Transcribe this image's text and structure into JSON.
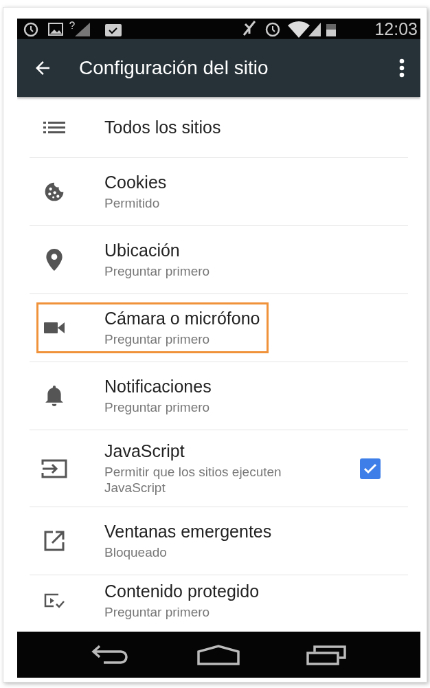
{
  "status_bar": {
    "time": "12:03"
  },
  "toolbar": {
    "title": "Configuración del sitio"
  },
  "items": [
    {
      "kind": "link",
      "title": "Todos los sitios",
      "highlighted": false
    },
    {
      "kind": "setting",
      "title": "Cookies",
      "subtitle": "Permitido",
      "highlighted": false
    },
    {
      "kind": "setting",
      "title": "Ubicación",
      "subtitle": "Preguntar primero",
      "highlighted": false
    },
    {
      "kind": "setting",
      "title": "Cámara o micrófono",
      "subtitle": "Preguntar primero",
      "highlighted": true
    },
    {
      "kind": "setting",
      "title": "Notificaciones",
      "subtitle": "Preguntar primero",
      "highlighted": false
    },
    {
      "kind": "checkbox",
      "title": "JavaScript",
      "subtitle": "Permitir que los sitios ejecuten JavaScript",
      "checked": true,
      "highlighted": false
    },
    {
      "kind": "setting",
      "title": "Ventanas emergentes",
      "subtitle": "Bloqueado",
      "highlighted": false
    },
    {
      "kind": "setting",
      "title": "Contenido protegido",
      "subtitle": "Preguntar primero",
      "highlighted": false
    }
  ]
}
